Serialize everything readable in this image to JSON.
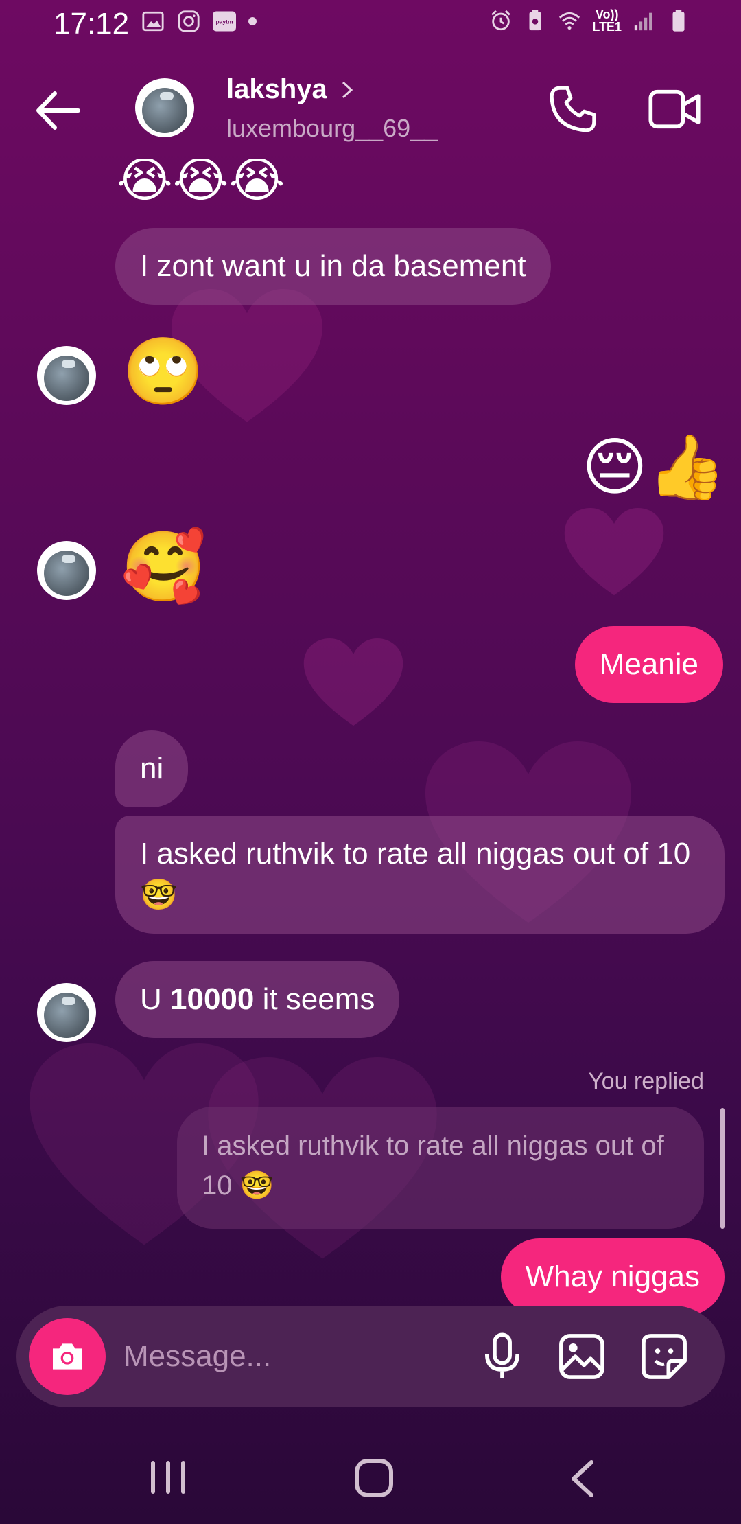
{
  "status_bar": {
    "time": "17:12",
    "left_icons": [
      "gallery-icon",
      "instagram-icon",
      "paytm-icon",
      "dot-icon"
    ],
    "paytm_label": "paytm",
    "right_icons": [
      "alarm-icon",
      "battery-saver-icon",
      "wifi-icon",
      "volte-icon",
      "signal-icon",
      "battery-icon"
    ],
    "volte_label": "Vo))",
    "lte_label": "LTE1"
  },
  "header": {
    "contact_name": "lakshya",
    "contact_handle": "luxembourg__69__",
    "icons": [
      "back-arrow-icon",
      "chevron-right-icon",
      "phone-icon",
      "video-camera-icon"
    ]
  },
  "messages": {
    "top_emojis": "😭😭😭",
    "m1": "I zont want u in da basement",
    "m2_emoji": "🙄",
    "m3_emoji": "😔👍",
    "m4_emoji": "🥰",
    "m5": "Meanie",
    "m6": "ni",
    "m7": "I asked ruthvik to rate all niggas out of 10 🤓",
    "m8_prefix": "U ",
    "m8_bold": "10000",
    "m8_suffix": " it seems",
    "you_replied": "You replied",
    "reply_quote": "I asked ruthvik to rate all niggas out of 10 🤓",
    "m9": "Whay niggas"
  },
  "composer": {
    "placeholder": "Message...",
    "icons": [
      "camera-icon",
      "microphone-icon",
      "gallery-icon",
      "sticker-icon"
    ]
  },
  "nav_bar": {
    "icons": [
      "recent-apps-icon",
      "home-icon",
      "back-icon"
    ]
  },
  "colors": {
    "outgoing_bubble": "#f5267d",
    "incoming_bubble": "#8e4886",
    "background_top": "#6e0a62",
    "background_bottom": "#2a0838"
  }
}
